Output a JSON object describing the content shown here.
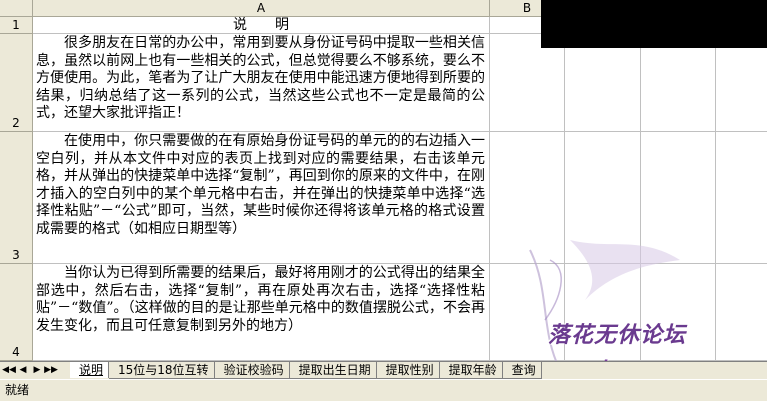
{
  "columns": [
    "A",
    "B"
  ],
  "rows": [
    "1",
    "2",
    "3",
    "4"
  ],
  "cells": {
    "a1": "说　　明",
    "a2": "很多朋友在日常的办公中，常用到要从身份证号码中提取一些相关信息，虽然以前网上也有一些相关的公式，但总觉得要么不够系统，要么不方便使用。为此，笔者为了让广大朋友在使用中能迅速方便地得到所要的结果，归纳总结了这一系列的公式，当然这些公式也不一定是最简的公式，还望大家批评指正！",
    "a3": "在使用中，你只需要做的在有原始身份证号码的单元的的右边插入一空白列，并从本文件中对应的表页上找到对应的需要结果，右击该单元格，并从弹出的快捷菜单中选择“复制”，再回到你的原来的文件中，在刚才插入的空白列中的某个单元格中右击，并在弹出的快捷菜单中选择“选择性粘贴”－“公式”即可，当然，某些时候你还得将该单元格的格式设置成需要的格式（如相应日期型等）",
    "a4": "当你认为已得到所需要的结果后，最好将用刚才的公式得出的结果全部选中，然后右击，选择“复制”，再在原处再次右击，选择“选择性粘贴”－“数值”。（这样做的目的是让那些单元格中的数值摆脱公式，不会再发生变化，而且可任意复制到另外的地方）"
  },
  "sheet_tabs": [
    "说明",
    "15位与18位互转",
    "验证校验码",
    "提取出生日期",
    "提取性别",
    "提取年龄",
    "查询"
  ],
  "active_tab": "说明",
  "nav_buttons": [
    "◀◀",
    "◀",
    "▶",
    "▶▶"
  ],
  "status": "就绪",
  "watermark": {
    "text": "落花无休论坛",
    "url": "www.luoan.cn"
  }
}
